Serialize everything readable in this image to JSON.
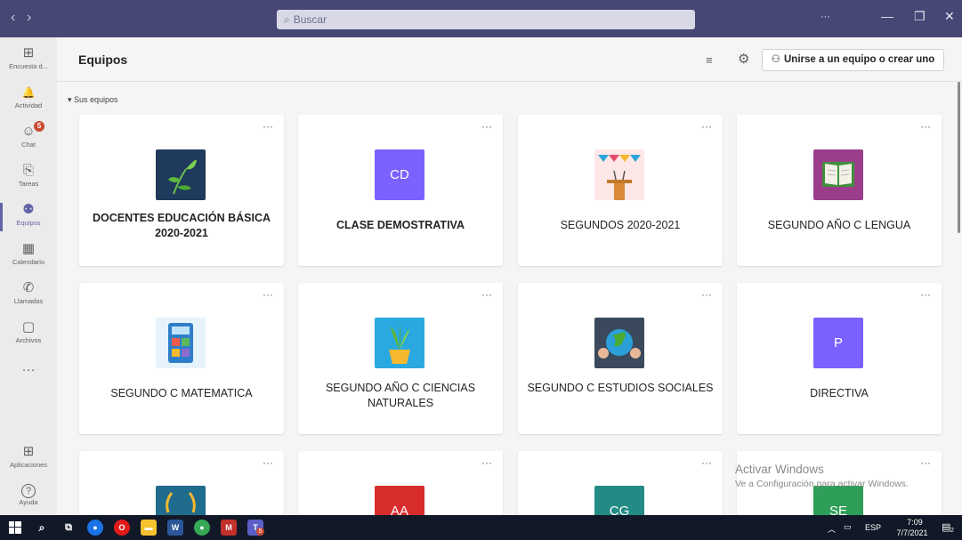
{
  "titlebar": {
    "back": "‹",
    "forward": "›",
    "search_placeholder": "Buscar",
    "more": "···",
    "minimize": "—",
    "maximize": "❐",
    "close": "✕"
  },
  "rail": {
    "items": [
      {
        "label": "Encuesta d...",
        "icon": "⊞"
      },
      {
        "label": "Actividad",
        "icon": "🔔"
      },
      {
        "label": "Chat",
        "icon": "☺",
        "badge": "5"
      },
      {
        "label": "Tareas",
        "icon": "⎘"
      },
      {
        "label": "Equipos",
        "icon": "⚉"
      },
      {
        "label": "Calendario",
        "icon": "▦"
      },
      {
        "label": "Llamadas",
        "icon": "✆"
      },
      {
        "label": "Archivos",
        "icon": "▢"
      }
    ],
    "more": "···",
    "apps_label": "Aplicaciones",
    "apps_icon": "⊞",
    "help_label": "Ayuda",
    "help_icon": "?"
  },
  "header": {
    "title": "Equipos",
    "filter_icon": "≡",
    "settings_icon": "⚙",
    "join_icon": "⚇",
    "join_label": "Unirse a un equipo o crear uno"
  },
  "section": {
    "label": "▾ Sus equipos"
  },
  "teams": [
    {
      "name": "DOCENTES EDUCACIÓN BÁSICA 2020-2021",
      "icon": "leaf-icon"
    },
    {
      "name": "CLASE DEMOSTRATIVA",
      "initials": "CD",
      "color": "#7b61ff"
    },
    {
      "name": "SEGUNDOS 2020-2021",
      "icon": "podium-icon"
    },
    {
      "name": "SEGUNDO AÑO C LENGUA",
      "icon": "book-icon"
    },
    {
      "name": "SEGUNDO C MATEMATICA",
      "icon": "calculator-icon"
    },
    {
      "name": "SEGUNDO AÑO C CIENCIAS NATURALES",
      "icon": "plant-icon"
    },
    {
      "name": "SEGUNDO C ESTUDIOS SOCIALES",
      "icon": "globe-icon"
    },
    {
      "name": "DIRECTIVA",
      "initials": "P",
      "color": "#7b61ff"
    },
    {
      "name": "",
      "icon": "laurel-icon"
    },
    {
      "name": "",
      "initials": "AA",
      "color": "#d92c2c"
    },
    {
      "name": "",
      "initials": "CG",
      "color": "#238b84"
    },
    {
      "name": "",
      "initials": "SE",
      "color": "#2e9e58"
    }
  ],
  "card_more": "···",
  "watermark": {
    "line1": "Activar Windows",
    "line2": "Ve a Configuración para activar Windows."
  },
  "taskbar": {
    "teams_badge": "5",
    "lang": "ESP",
    "time": "7:09",
    "date": "7/7/2021",
    "notif_count": "2"
  }
}
